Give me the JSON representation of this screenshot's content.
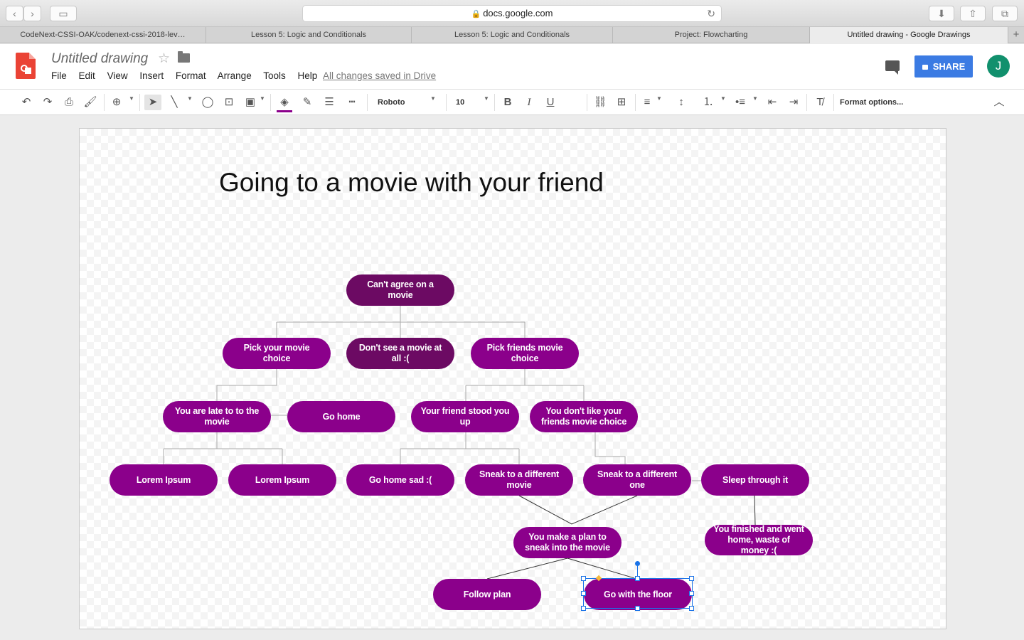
{
  "browser": {
    "url": "docs.google.com",
    "tabs": [
      {
        "label": "CodeNext-CSSI-OAK/codenext-cssi-2018-lev…"
      },
      {
        "label": "Lesson 5: Logic and Conditionals"
      },
      {
        "label": "Lesson 5: Logic and Conditionals"
      },
      {
        "label": "Project: Flowcharting"
      },
      {
        "label": "Untitled drawing - Google Drawings"
      }
    ]
  },
  "header": {
    "title": "Untitled drawing",
    "menu": [
      "File",
      "Edit",
      "View",
      "Insert",
      "Format",
      "Arrange",
      "Tools",
      "Help"
    ],
    "save_status": "All changes saved in Drive",
    "share_label": "SHARE",
    "avatar_initial": "J"
  },
  "toolbar": {
    "font": "Roboto",
    "font_size": "10",
    "format_options": "Format options..."
  },
  "diagram": {
    "title": "Going to a movie with your friend",
    "nodes": {
      "root": "Can't agree  on a movie",
      "pick_yours": "Pick your movie choice",
      "no_movie": "Don't see a movie at all :(",
      "pick_friends": "Pick friends movie choice",
      "late": "You are late to to the movie",
      "go_home": "Go home",
      "stood_up": "Your friend stood you up",
      "dont_like": "You don't like your friends movie choice",
      "lorem1": "Lorem Ipsum",
      "lorem2": "Lorem Ipsum",
      "go_home_sad": "Go home sad :(",
      "sneak_movie": "Sneak to a different movie",
      "sneak_one": "Sneak to a different one",
      "sleep": "Sleep through it",
      "plan": "You make a plan to sneak into the movie",
      "finished": "You finished and went home, waste of money :(",
      "follow_plan": "Follow plan",
      "go_floor": "Go with the floor"
    }
  }
}
